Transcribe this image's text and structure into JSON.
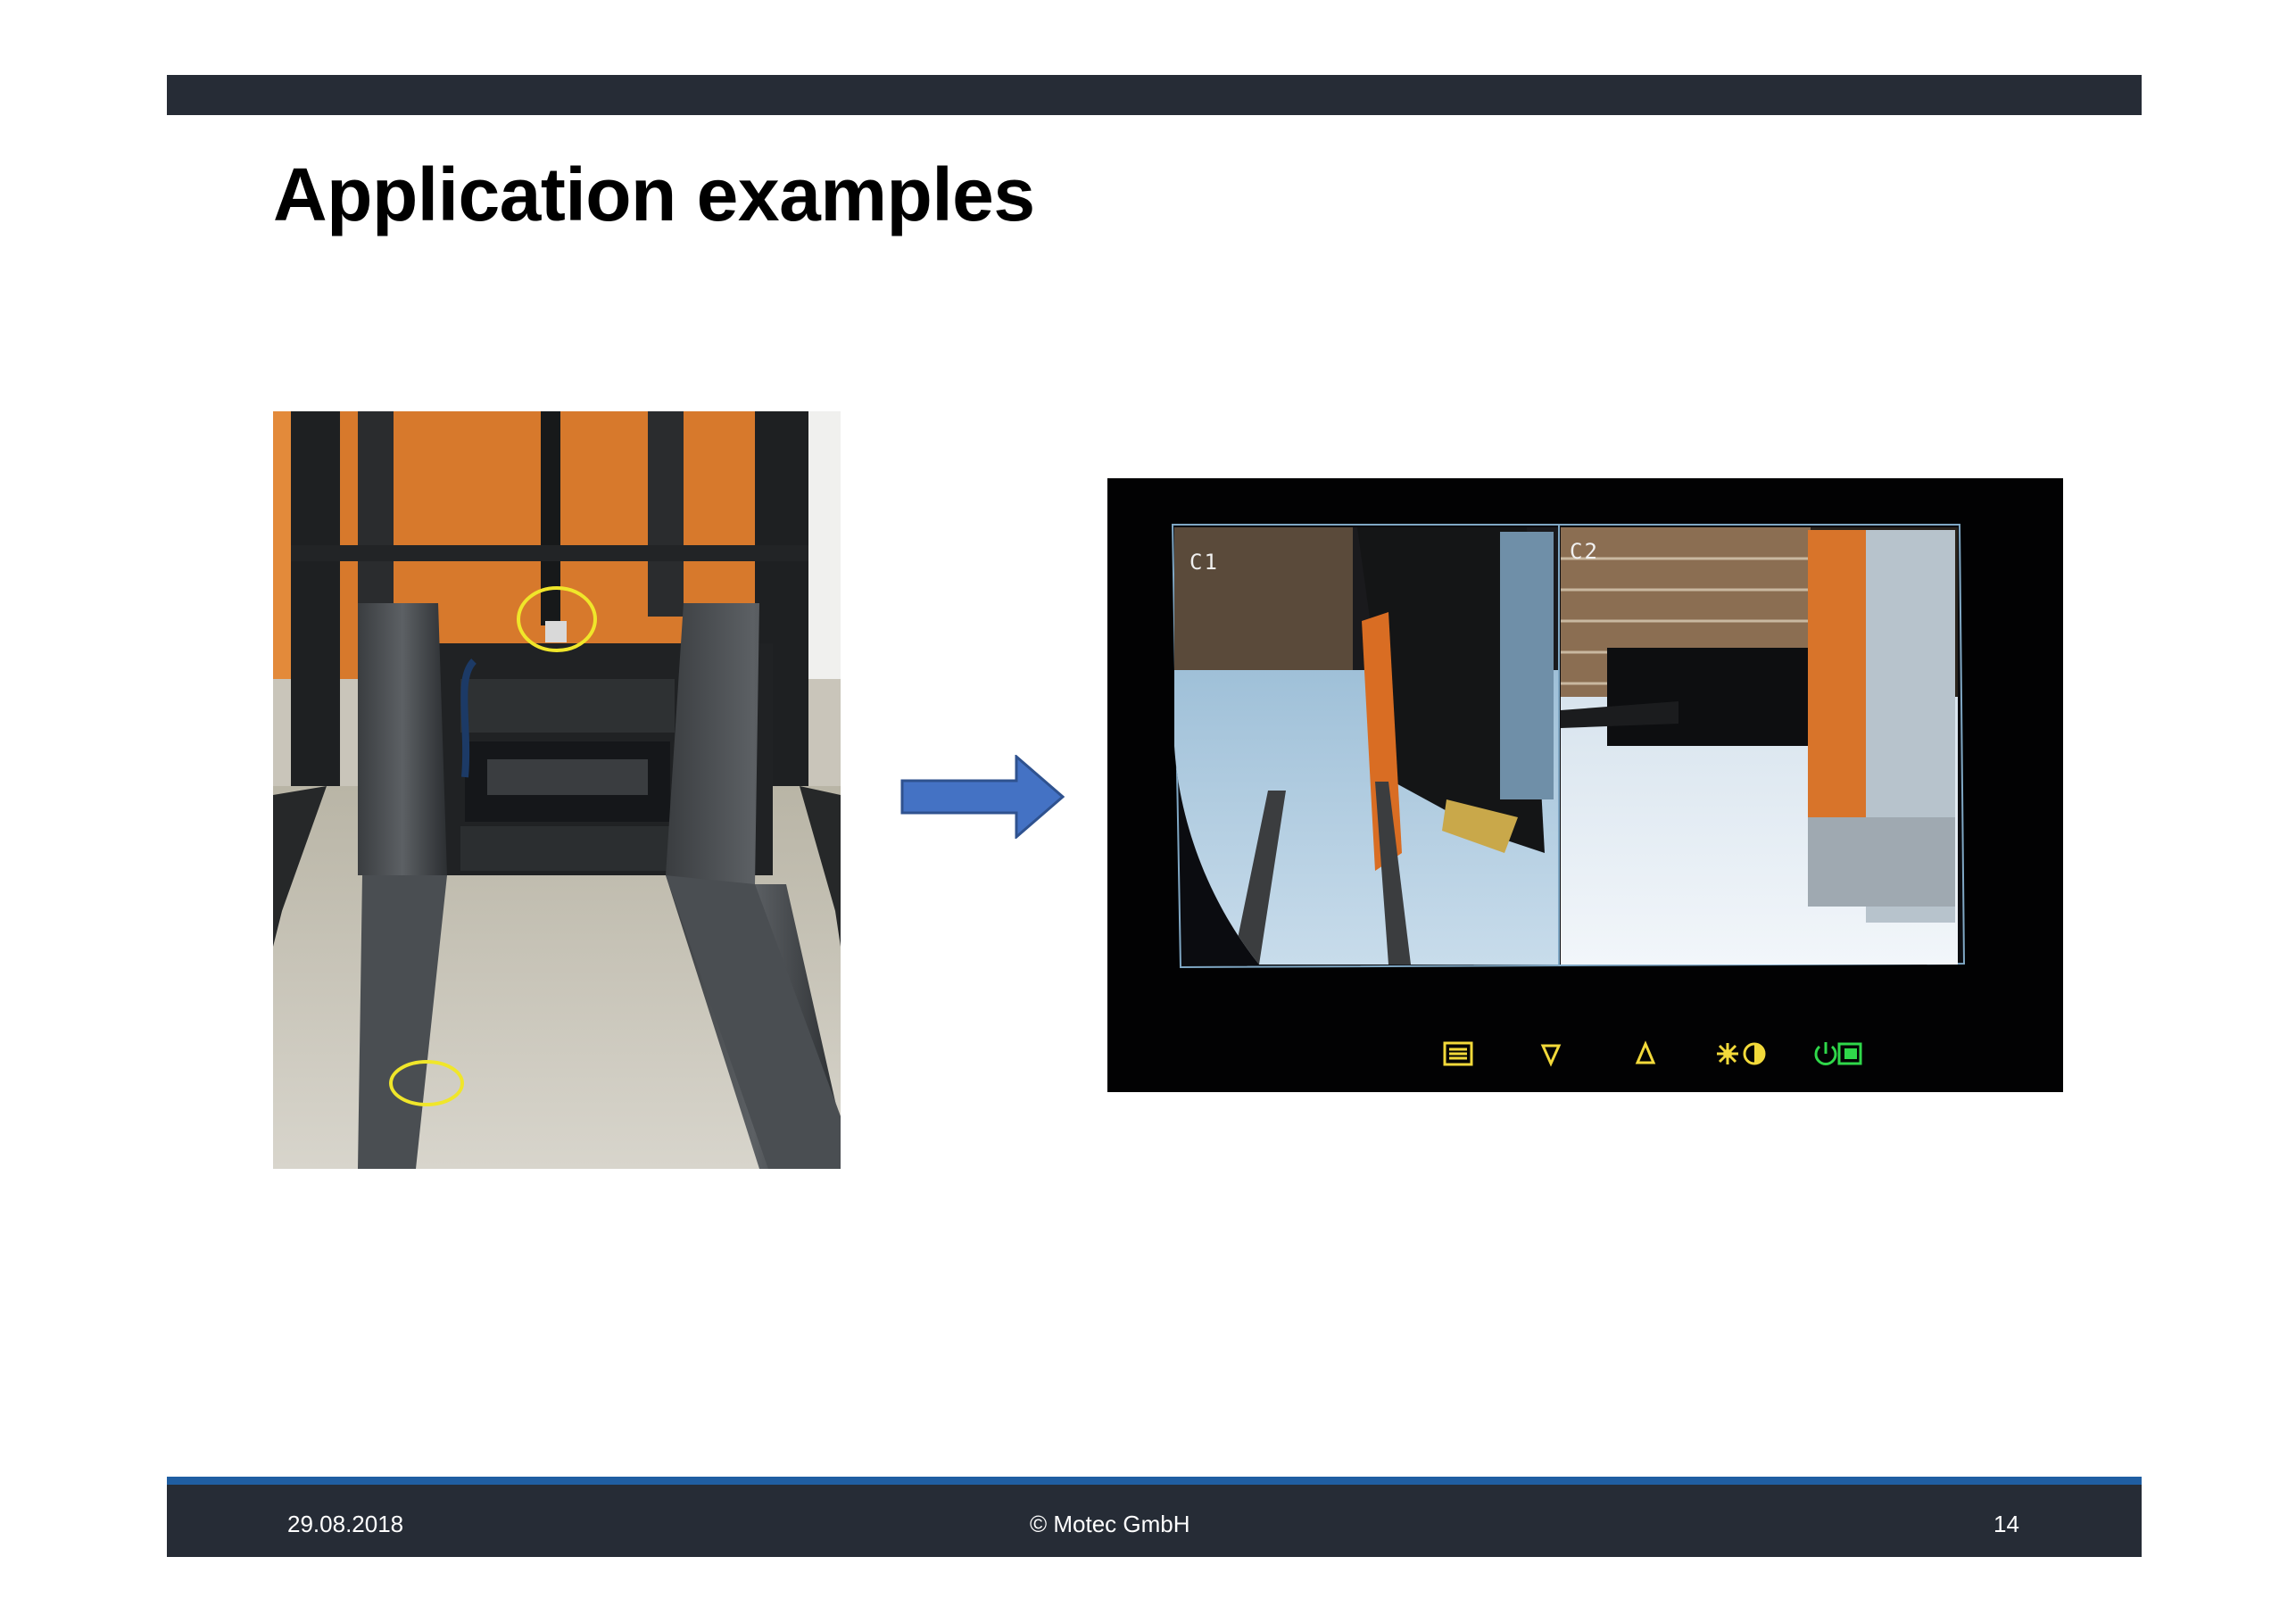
{
  "slide": {
    "title": "Application examples"
  },
  "monitor": {
    "camera_1_label": "C1",
    "camera_2_label": "C2",
    "buttons": [
      "menu-icon",
      "down-triangle-icon",
      "up-triangle-icon",
      "brightness-contrast-icon",
      "power-camera-icon"
    ],
    "button_colors": {
      "yellow": "#f2d93a",
      "green": "#2fd84a"
    }
  },
  "colors": {
    "header_bar": "#262c36",
    "footer_bar": "#262c36",
    "footer_stripe": "#1f5ea2",
    "arrow_fill": "#4472c4",
    "highlight_circle": "#f0e62a"
  },
  "footer": {
    "date": "29.08.2018",
    "copyright": "© Motec GmbH",
    "page_number": "14"
  }
}
